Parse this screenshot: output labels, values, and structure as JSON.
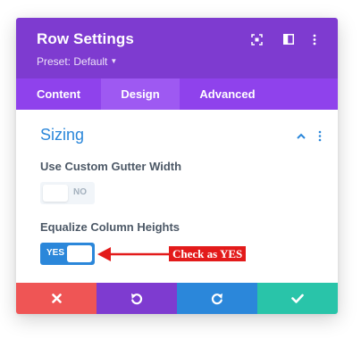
{
  "header": {
    "title": "Row Settings",
    "preset_label": "Preset: Default",
    "icons": [
      "focus-icon",
      "sidebar-toggle-icon",
      "more-vertical-icon"
    ],
    "bg_color": "#7e3bd0"
  },
  "tabs": [
    {
      "label": "Content",
      "active": false
    },
    {
      "label": "Design",
      "active": true
    },
    {
      "label": "Advanced",
      "active": false
    }
  ],
  "section": {
    "title": "Sizing",
    "collapsed": false,
    "icons": [
      "chevron-up-icon",
      "more-vertical-icon"
    ]
  },
  "fields": {
    "gutter": {
      "label": "Use Custom Gutter Width",
      "value": "NO",
      "enabled": false
    },
    "equalize": {
      "label": "Equalize Column Heights",
      "value": "YES",
      "enabled": true
    }
  },
  "annotation": {
    "text": "Check as YES",
    "color": "#e31a1a"
  },
  "footer": {
    "buttons": [
      {
        "name": "cancel",
        "icon": "close-icon",
        "color": "#ef5555"
      },
      {
        "name": "undo",
        "icon": "undo-icon",
        "color": "#7e3bd0"
      },
      {
        "name": "redo",
        "icon": "redo-icon",
        "color": "#2b87da"
      },
      {
        "name": "save",
        "icon": "check-icon",
        "color": "#29c4a9"
      }
    ]
  }
}
